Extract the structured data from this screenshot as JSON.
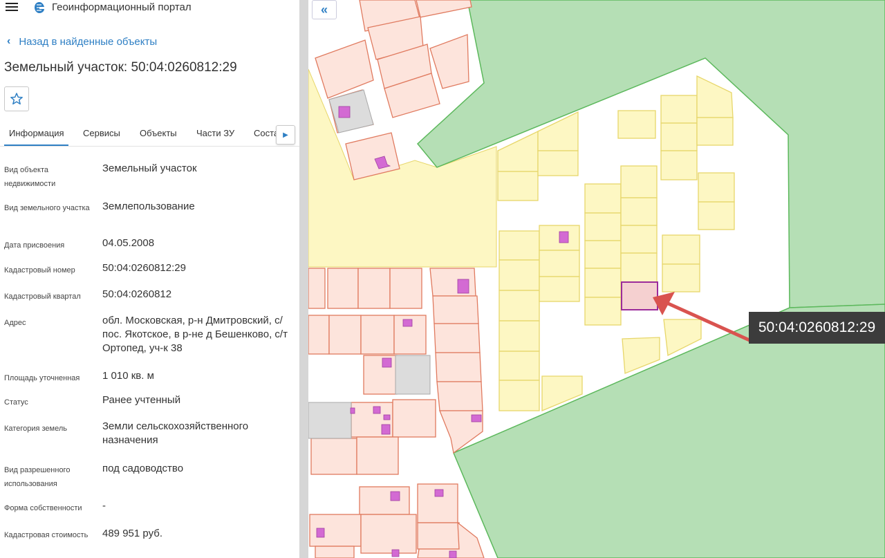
{
  "header": {
    "app_title": "Геоинформационный портал"
  },
  "nav": {
    "back_label": "Назад в найденные объекты"
  },
  "object": {
    "title": "Земельный участок: 50:04:0260812:29",
    "favorite_icon": "star-icon"
  },
  "tabs": [
    {
      "label": "Информация",
      "active": true
    },
    {
      "label": "Сервисы"
    },
    {
      "label": "Объекты"
    },
    {
      "label": "Части ЗУ"
    },
    {
      "label": "Соста"
    }
  ],
  "tabs_next_icon": "caret-right-icon",
  "info": [
    {
      "label": "Вид объекта недвижимости",
      "value": "Земельный участок"
    },
    {
      "label": "Вид земельного участка",
      "value": "Землепользование"
    },
    {
      "label": "Дата присвоения",
      "value": "04.05.2008"
    },
    {
      "label": "Кадастровый номер",
      "value": "50:04:0260812:29"
    },
    {
      "label": "Кадастровый квартал",
      "value": "50:04:0260812"
    },
    {
      "label": "Адрес",
      "value": "обл. Московская, р-н Дмитровский, с/пос. Якотское, в р-не д Бешенково, с/т Ортопед, уч-к 38"
    },
    {
      "label": "Площадь уточненная",
      "value": "1 010 кв. м"
    },
    {
      "label": "Статус",
      "value": "Ранее учтенный"
    },
    {
      "label": "Категория земель",
      "value": "Земли сельскохозяйственного назначения"
    },
    {
      "label": "Вид разрешенного использования",
      "value": "под садоводство"
    },
    {
      "label": "Форма собственности",
      "value": "-"
    },
    {
      "label": "Кадастровая стоимость",
      "value": "489 951 руб."
    }
  ],
  "map": {
    "collapse_icon": "double-chevron-left-icon",
    "callout_label": "50:04:0260812:29",
    "colors": {
      "forest": "#b5dfb5",
      "forest_border": "#5cb85c",
      "parcel_yellow_fill": "#fdf7c3",
      "parcel_yellow_border": "#e7d66a",
      "parcel_red_fill": "#fde4dc",
      "parcel_red_border": "#e07a5f",
      "building": "#d36ad3",
      "selected_border": "#9b2b9b",
      "arrow": "#d9534f",
      "callout_bg": "#3c3c3c"
    }
  }
}
